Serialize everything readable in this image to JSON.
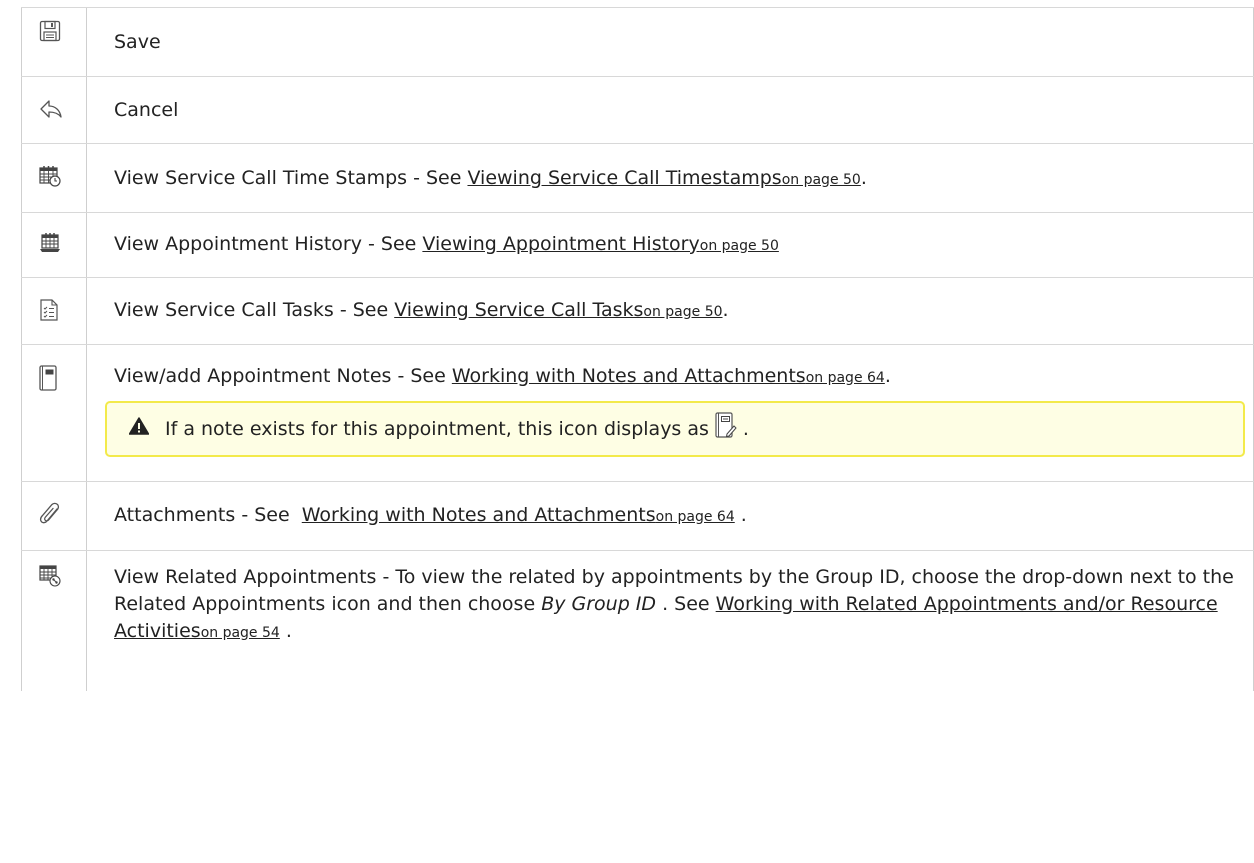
{
  "rows": [
    {
      "icon": "save-icon",
      "text": "Save"
    },
    {
      "icon": "cancel-icon",
      "text": "Cancel"
    },
    {
      "icon": "timestamps-icon",
      "text": "View Service Call Time Stamps - See ",
      "link": "Viewing Service Call Timestamps",
      "page": "on page 50",
      "suffix": "."
    },
    {
      "icon": "appointment-history-icon",
      "text": "View Appointment History - See ",
      "link": "Viewing Appointment History",
      "page": "on page 50",
      "suffix": ""
    },
    {
      "icon": "tasks-icon",
      "text": "View Service Call Tasks - See ",
      "link": "Viewing Service Call Tasks",
      "page": "on page 50",
      "suffix": "."
    },
    {
      "icon": "notes-icon",
      "text": "View/add Appointment Notes - See ",
      "link": "Working with Notes and Attachments",
      "page": "on page 64",
      "suffix": ".",
      "note": {
        "before": "If a note exists for this appointment, this icon displays as",
        "after": "."
      }
    },
    {
      "icon": "paperclip-icon",
      "text": "Attachments - See  ",
      "link": "Working with Notes and Attachments",
      "page": "on page 64",
      "suffix": " ."
    },
    {
      "icon": "related-appointments-icon",
      "text_a": "View Related Appointments - To view the related by appointments by the Group ID, choose the drop-down next to the Related Appointments icon and then choose ",
      "italic": "By Group ID",
      "text_b": " . See ",
      "link": "Working with Related Appointments and/or Resource Activities",
      "page": "on page 54",
      "suffix": " ."
    }
  ]
}
